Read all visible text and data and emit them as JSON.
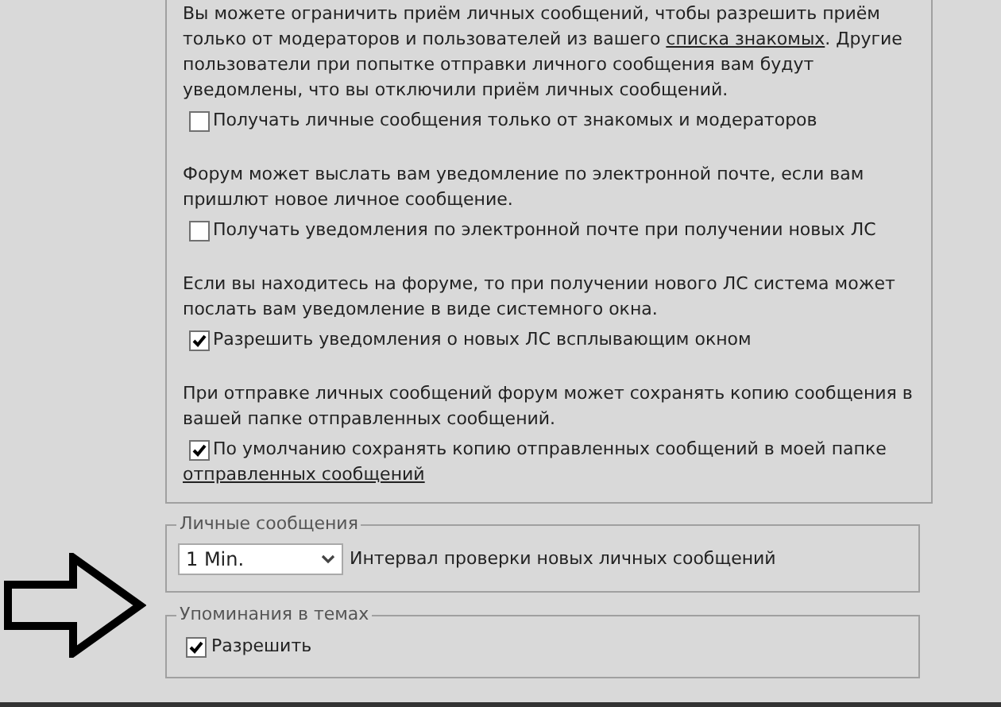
{
  "pm_settings": [
    {
      "text_before": "Вы можете ограничить приём личных сообщений, чтобы разрешить приём только от модераторов и пользователей из вашего ",
      "link": "списка знакомых",
      "text_after": ". Другие пользователи при попытке отправки личного сообщения вам будут уведомлены, что вы отключили приём личных сообщений.",
      "checkbox": {
        "label": "Получать личные сообщения только от знакомых и модераторов",
        "checked": false
      }
    },
    {
      "text_before": "Форум может выслать вам уведомление по электронной почте, если вам пришлют новое личное сообщение.",
      "checkbox": {
        "label": "Получать уведомления по электронной почте при получении новых ЛС",
        "checked": false
      }
    },
    {
      "text_before": "Если вы находитесь на форуме, то при получении нового ЛС система может послать вам уведомление в виде системного окна.",
      "checkbox": {
        "label": "Разрешить уведомления о новых ЛС всплывающим окном",
        "checked": true
      }
    },
    {
      "text_before": "При отправке личных сообщений форум может сохранять копию сообщения в вашей папке отправленных сообщений.",
      "checkbox": {
        "label": "По умолчанию сохранять копию отправленных сообщений в моей папке",
        "link": "отправленных сообщений",
        "checked": true
      }
    }
  ],
  "private_messages": {
    "legend": "Личные сообщения",
    "select_value": "1 Min.",
    "label": "Интервал проверки новых личных сообщений"
  },
  "mentions": {
    "legend": "Упоминания в темах",
    "checkbox": {
      "label": "Разрешить",
      "checked": true
    }
  }
}
